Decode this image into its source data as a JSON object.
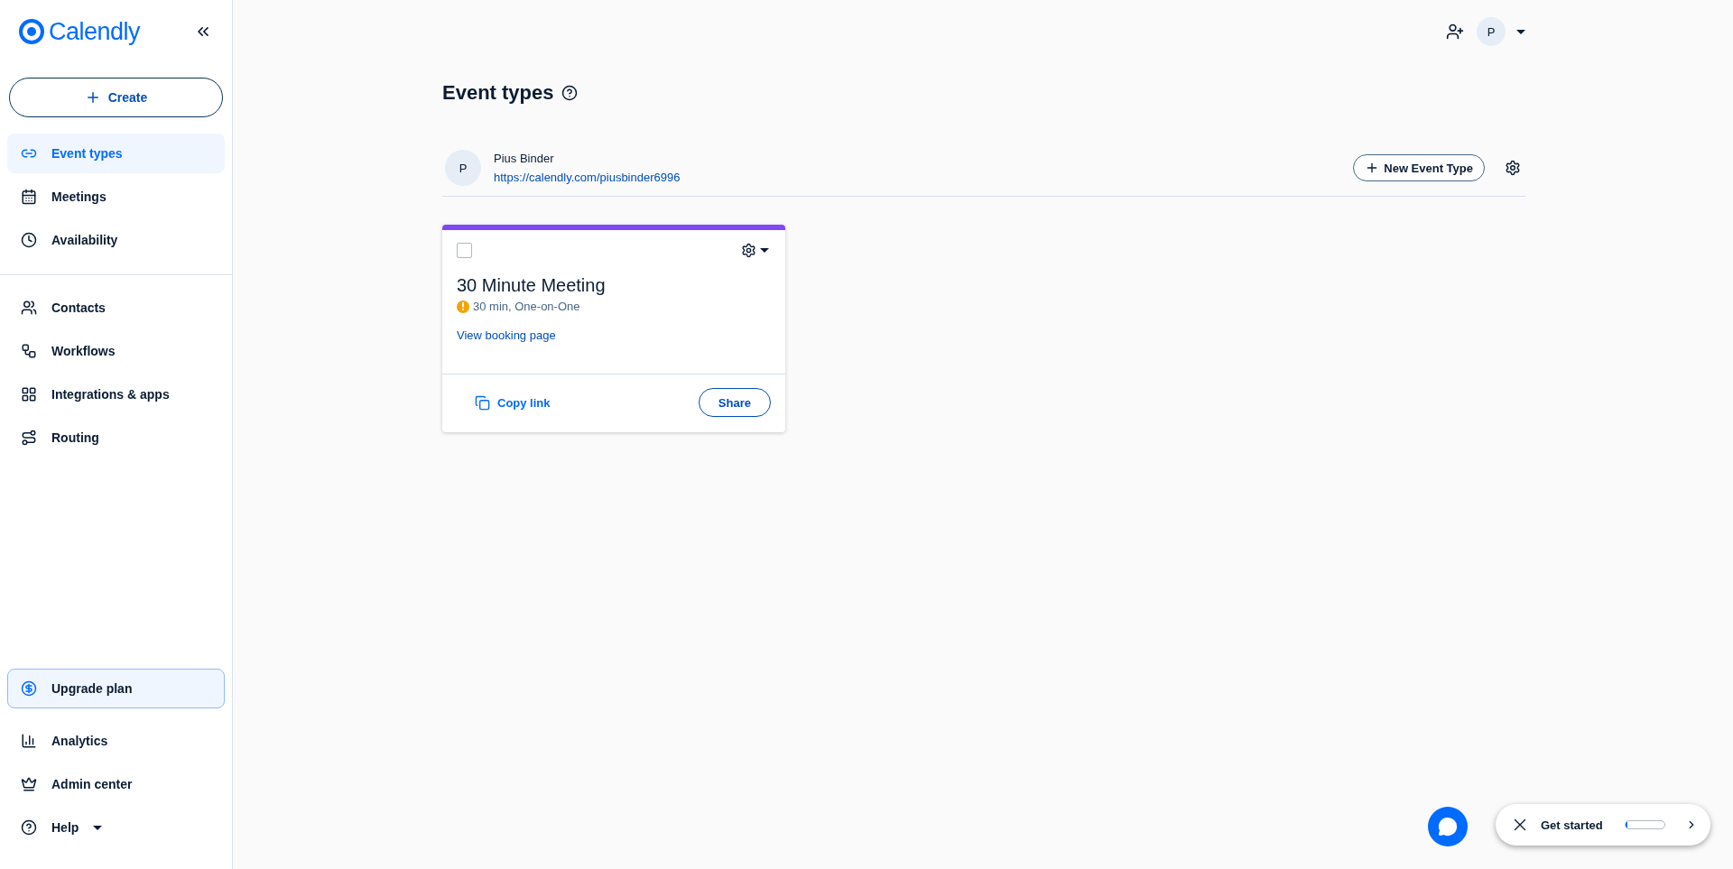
{
  "sidebar": {
    "logo": "Calendly",
    "create_button": "Create",
    "nav_top": [
      {
        "label": "Event types",
        "selected": true
      },
      {
        "label": "Meetings",
        "selected": false
      },
      {
        "label": "Availability",
        "selected": false
      }
    ],
    "nav_middle": [
      {
        "label": "Contacts",
        "selected": false
      },
      {
        "label": "Workflows",
        "selected": false
      },
      {
        "label": "Integrations & apps",
        "selected": false
      },
      {
        "label": "Routing",
        "selected": false
      }
    ],
    "upgrade": "Upgrade plan",
    "nav_bottom": [
      {
        "label": "Analytics",
        "selected": false
      },
      {
        "label": "Admin center",
        "selected": false
      },
      {
        "label": "Help",
        "selected": false
      }
    ]
  },
  "topbar": {
    "avatar": "P"
  },
  "page": {
    "title": "Event types",
    "profile": {
      "avatar": "P",
      "name": "Pius Binder",
      "url": "https://calendly.com/piusbinder6996"
    },
    "new_button": "New Event Type",
    "cards": [
      {
        "color": "#8247f5",
        "checked": false,
        "title": "30 Minute Meeting",
        "details": "30 min, One-on-One",
        "link": "View booking page",
        "copy": "Copy link",
        "share": "Share"
      }
    ]
  },
  "get_started": {
    "label": "Get started",
    "level": 0.05
  }
}
